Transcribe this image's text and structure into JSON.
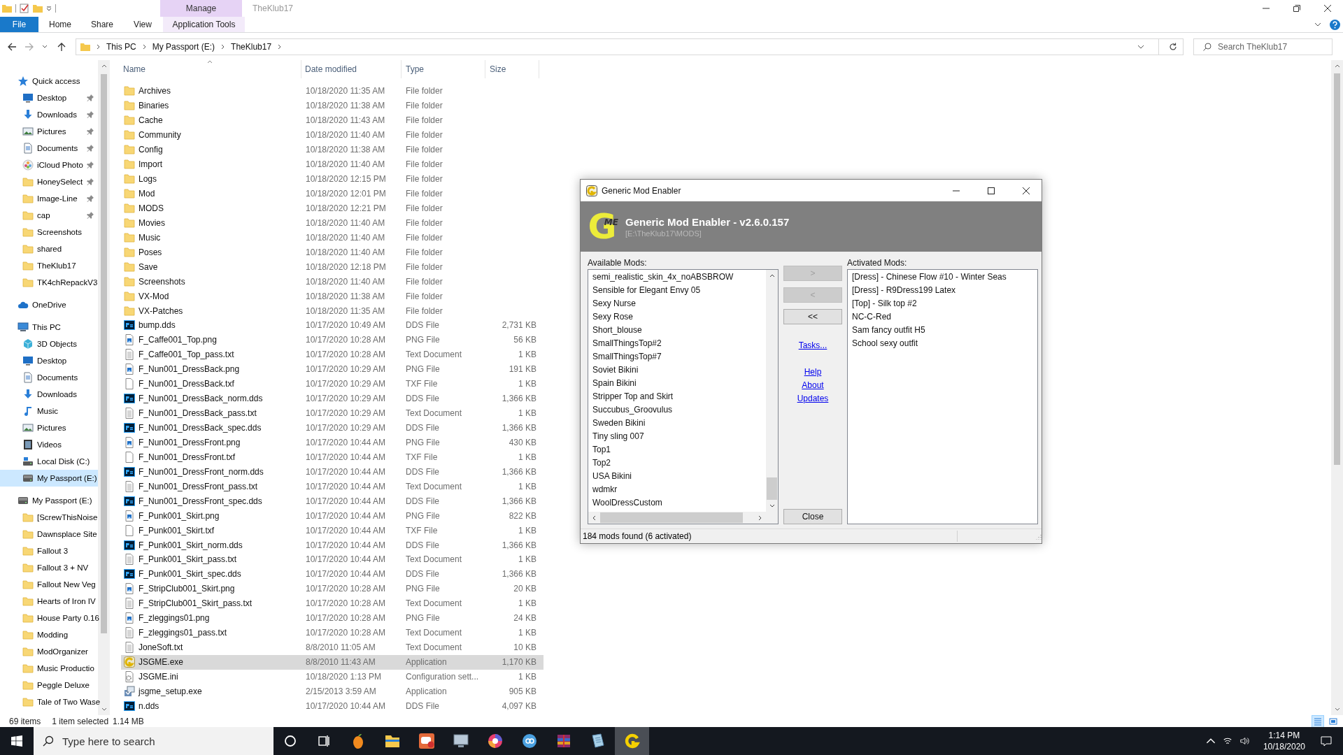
{
  "window": {
    "title": "TheKlub17",
    "context_tab": "Manage"
  },
  "ribbon": {
    "tabs": [
      {
        "label": "File",
        "kind": "file"
      },
      {
        "label": "Home",
        "kind": "tab"
      },
      {
        "label": "Share",
        "kind": "tab"
      },
      {
        "label": "View",
        "kind": "tab"
      },
      {
        "label": "Application Tools",
        "kind": "context"
      }
    ]
  },
  "address": {
    "crumbs": [
      "This PC",
      "My Passport (E:)",
      "TheKlub17"
    ]
  },
  "search": {
    "placeholder": "Search TheKlub17"
  },
  "sidebar": {
    "groups": [
      {
        "label": "Quick access",
        "kind": "star",
        "selected": false,
        "children": [
          {
            "label": "Desktop",
            "kind": "desktop",
            "pinned": true,
            "selected": false
          },
          {
            "label": "Downloads",
            "kind": "download",
            "pinned": true,
            "selected": false
          },
          {
            "label": "Pictures",
            "kind": "pictures",
            "pinned": true,
            "selected": false
          },
          {
            "label": "Documents",
            "kind": "documents",
            "pinned": true,
            "selected": false
          },
          {
            "label": "iCloud Photo",
            "kind": "photos",
            "pinned": true,
            "selected": false
          },
          {
            "label": "HoneySelect",
            "kind": "folder",
            "pinned": true,
            "selected": false
          },
          {
            "label": "Image-Line",
            "kind": "folder",
            "pinned": true,
            "selected": false
          },
          {
            "label": "cap",
            "kind": "folder",
            "pinned": true,
            "selected": false
          },
          {
            "label": "Screenshots",
            "kind": "folder",
            "pinned": false,
            "selected": false
          },
          {
            "label": "shared",
            "kind": "folder",
            "pinned": false,
            "selected": false
          },
          {
            "label": "TheKlub17",
            "kind": "folder",
            "pinned": false,
            "selected": false
          },
          {
            "label": "TK4chRepackV3",
            "kind": "folder",
            "pinned": false,
            "selected": false
          }
        ]
      },
      {
        "label": "OneDrive",
        "kind": "cloud",
        "selected": false
      },
      {
        "label": "This PC",
        "kind": "pc",
        "selected": false,
        "children": [
          {
            "label": "3D Objects",
            "kind": "cube",
            "selected": false
          },
          {
            "label": "Desktop",
            "kind": "desktop",
            "selected": false
          },
          {
            "label": "Documents",
            "kind": "documents",
            "selected": false
          },
          {
            "label": "Downloads",
            "kind": "download",
            "selected": false
          },
          {
            "label": "Music",
            "kind": "music",
            "selected": false
          },
          {
            "label": "Pictures",
            "kind": "pictures",
            "selected": false
          },
          {
            "label": "Videos",
            "kind": "video",
            "selected": false
          },
          {
            "label": "Local Disk (C:)",
            "kind": "disk",
            "selected": false
          },
          {
            "label": "My Passport (E:)",
            "kind": "drive",
            "selected": true
          }
        ]
      },
      {
        "label": "My Passport (E:)",
        "kind": "drive",
        "selected": false,
        "children": [
          {
            "label": "[ScrewThisNoise",
            "kind": "folder",
            "selected": false
          },
          {
            "label": "Dawnsplace Site",
            "kind": "folder",
            "selected": false
          },
          {
            "label": "Fallout 3",
            "kind": "folder",
            "selected": false
          },
          {
            "label": "Fallout 3 + NV",
            "kind": "folder",
            "selected": false
          },
          {
            "label": "Fallout New Veg",
            "kind": "folder",
            "selected": false
          },
          {
            "label": "Hearts of Iron IV",
            "kind": "folder",
            "selected": false
          },
          {
            "label": "House Party 0.16",
            "kind": "folder",
            "selected": false
          },
          {
            "label": "Modding",
            "kind": "folder",
            "selected": false
          },
          {
            "label": "ModOrganizer",
            "kind": "folder",
            "selected": false
          },
          {
            "label": "Music Productio",
            "kind": "folder",
            "selected": false
          },
          {
            "label": "Peggle Deluxe",
            "kind": "folder",
            "selected": false
          },
          {
            "label": "Tale of Two Wase",
            "kind": "folder",
            "selected": false
          }
        ]
      }
    ]
  },
  "columns": [
    "Name",
    "Date modified",
    "Type",
    "Size"
  ],
  "files": [
    {
      "name": "Archives",
      "date": "10/18/2020 11:35 AM",
      "type": "File folder",
      "kind": "folder",
      "selected": false
    },
    {
      "name": "Binaries",
      "date": "10/18/2020 11:38 AM",
      "type": "File folder",
      "kind": "folder",
      "selected": false
    },
    {
      "name": "Cache",
      "date": "10/18/2020 11:43 AM",
      "type": "File folder",
      "kind": "folder",
      "selected": false
    },
    {
      "name": "Community",
      "date": "10/18/2020 11:40 AM",
      "type": "File folder",
      "kind": "folder",
      "selected": false
    },
    {
      "name": "Config",
      "date": "10/18/2020 11:38 AM",
      "type": "File folder",
      "kind": "folder",
      "selected": false
    },
    {
      "name": "Import",
      "date": "10/18/2020 11:40 AM",
      "type": "File folder",
      "kind": "folder",
      "selected": false
    },
    {
      "name": "Logs",
      "date": "10/18/2020 12:15 PM",
      "type": "File folder",
      "kind": "folder",
      "selected": false
    },
    {
      "name": "Mod",
      "date": "10/18/2020 12:01 PM",
      "type": "File folder",
      "kind": "folder",
      "selected": false
    },
    {
      "name": "MODS",
      "date": "10/18/2020 12:21 PM",
      "type": "File folder",
      "kind": "folder",
      "selected": false
    },
    {
      "name": "Movies",
      "date": "10/18/2020 11:40 AM",
      "type": "File folder",
      "kind": "folder",
      "selected": false
    },
    {
      "name": "Music",
      "date": "10/18/2020 11:40 AM",
      "type": "File folder",
      "kind": "folder",
      "selected": false
    },
    {
      "name": "Poses",
      "date": "10/18/2020 11:40 AM",
      "type": "File folder",
      "kind": "folder",
      "selected": false
    },
    {
      "name": "Save",
      "date": "10/18/2020 12:18 PM",
      "type": "File folder",
      "kind": "folder",
      "selected": false
    },
    {
      "name": "Screenshots",
      "date": "10/18/2020 11:40 AM",
      "type": "File folder",
      "kind": "folder",
      "selected": false
    },
    {
      "name": "VX-Mod",
      "date": "10/18/2020 11:38 AM",
      "type": "File folder",
      "kind": "folder",
      "selected": false
    },
    {
      "name": "VX-Patches",
      "date": "10/18/2020 11:35 AM",
      "type": "File folder",
      "kind": "folder",
      "selected": false
    },
    {
      "name": "bump.dds",
      "date": "10/17/2020 10:49 AM",
      "type": "DDS File",
      "size": "2,731 KB",
      "kind": "dds",
      "selected": false
    },
    {
      "name": "F_Caffe001_Top.png",
      "date": "10/17/2020 10:28 AM",
      "type": "PNG File",
      "size": "56 KB",
      "kind": "image",
      "selected": false
    },
    {
      "name": "F_Caffe001_Top_pass.txt",
      "date": "10/17/2020 10:28 AM",
      "type": "Text Document",
      "size": "1 KB",
      "kind": "text",
      "selected": false
    },
    {
      "name": "F_Nun001_DressBack.png",
      "date": "10/17/2020 10:29 AM",
      "type": "PNG File",
      "size": "191 KB",
      "kind": "image",
      "selected": false
    },
    {
      "name": "F_Nun001_DressBack.txf",
      "date": "10/17/2020 10:29 AM",
      "type": "TXF File",
      "size": "1 KB",
      "kind": "blank",
      "selected": false
    },
    {
      "name": "F_Nun001_DressBack_norm.dds",
      "date": "10/17/2020 10:29 AM",
      "type": "DDS File",
      "size": "1,366 KB",
      "kind": "dds",
      "selected": false
    },
    {
      "name": "F_Nun001_DressBack_pass.txt",
      "date": "10/17/2020 10:29 AM",
      "type": "Text Document",
      "size": "1 KB",
      "kind": "text",
      "selected": false
    },
    {
      "name": "F_Nun001_DressBack_spec.dds",
      "date": "10/17/2020 10:29 AM",
      "type": "DDS File",
      "size": "1,366 KB",
      "kind": "dds",
      "selected": false
    },
    {
      "name": "F_Nun001_DressFront.png",
      "date": "10/17/2020 10:44 AM",
      "type": "PNG File",
      "size": "430 KB",
      "kind": "image",
      "selected": false
    },
    {
      "name": "F_Nun001_DressFront.txf",
      "date": "10/17/2020 10:44 AM",
      "type": "TXF File",
      "size": "1 KB",
      "kind": "blank",
      "selected": false
    },
    {
      "name": "F_Nun001_DressFront_norm.dds",
      "date": "10/17/2020 10:44 AM",
      "type": "DDS File",
      "size": "1,366 KB",
      "kind": "dds",
      "selected": false
    },
    {
      "name": "F_Nun001_DressFront_pass.txt",
      "date": "10/17/2020 10:44 AM",
      "type": "Text Document",
      "size": "1 KB",
      "kind": "text",
      "selected": false
    },
    {
      "name": "F_Nun001_DressFront_spec.dds",
      "date": "10/17/2020 10:44 AM",
      "type": "DDS File",
      "size": "1,366 KB",
      "kind": "dds",
      "selected": false
    },
    {
      "name": "F_Punk001_Skirt.png",
      "date": "10/17/2020 10:44 AM",
      "type": "PNG File",
      "size": "822 KB",
      "kind": "image",
      "selected": false
    },
    {
      "name": "F_Punk001_Skirt.txf",
      "date": "10/17/2020 10:44 AM",
      "type": "TXF File",
      "size": "1 KB",
      "kind": "blank",
      "selected": false
    },
    {
      "name": "F_Punk001_Skirt_norm.dds",
      "date": "10/17/2020 10:44 AM",
      "type": "DDS File",
      "size": "1,366 KB",
      "kind": "dds",
      "selected": false
    },
    {
      "name": "F_Punk001_Skirt_pass.txt",
      "date": "10/17/2020 10:44 AM",
      "type": "Text Document",
      "size": "1 KB",
      "kind": "text",
      "selected": false
    },
    {
      "name": "F_Punk001_Skirt_spec.dds",
      "date": "10/17/2020 10:44 AM",
      "type": "DDS File",
      "size": "1,366 KB",
      "kind": "dds",
      "selected": false
    },
    {
      "name": "F_StripClub001_Skirt.png",
      "date": "10/17/2020 10:28 AM",
      "type": "PNG File",
      "size": "20 KB",
      "kind": "image",
      "selected": false
    },
    {
      "name": "F_StripClub001_Skirt_pass.txt",
      "date": "10/17/2020 10:28 AM",
      "type": "Text Document",
      "size": "1 KB",
      "kind": "text",
      "selected": false
    },
    {
      "name": "F_zleggings01.png",
      "date": "10/17/2020 10:28 AM",
      "type": "PNG File",
      "size": "24 KB",
      "kind": "image",
      "selected": false
    },
    {
      "name": "F_zleggings01_pass.txt",
      "date": "10/17/2020 10:28 AM",
      "type": "Text Document",
      "size": "1 KB",
      "kind": "text",
      "selected": false
    },
    {
      "name": "JoneSoft.txt",
      "date": "8/8/2010 11:05 AM",
      "type": "Text Document",
      "size": "10 KB",
      "kind": "text",
      "selected": false
    },
    {
      "name": "JSGME.exe",
      "date": "8/8/2010 11:43 AM",
      "type": "Application",
      "size": "1,170 KB",
      "kind": "gme",
      "selected": true
    },
    {
      "name": "JSGME.ini",
      "date": "10/18/2020 1:13 PM",
      "type": "Configuration sett...",
      "size": "1 KB",
      "kind": "config",
      "selected": false
    },
    {
      "name": "jsgme_setup.exe",
      "date": "2/15/2013 3:59 AM",
      "type": "Application",
      "size": "905 KB",
      "kind": "setup",
      "selected": false
    },
    {
      "name": "n.dds",
      "date": "10/17/2020 10:44 AM",
      "type": "DDS File",
      "size": "4,097 KB",
      "kind": "dds",
      "selected": false
    }
  ],
  "status_bar": {
    "count": "69 items",
    "selection": "1 item selected",
    "size": "1.14 MB"
  },
  "dialog": {
    "title": "Generic Mod Enabler",
    "logo": {
      "letter": "G",
      "mark": "ME"
    },
    "heading": "Generic Mod Enabler - v2.6.0.157",
    "path": "[E:\\TheKlub17\\MODS]",
    "available_label": "Available Mods:",
    "available": [
      "semi_realistic_skin_4x_noABSBROW",
      "Sensible for Elegant Envy 05",
      "Sexy Nurse",
      "Sexy Rose",
      "Short_blouse",
      "SmallThingsTop#2",
      "SmallThingsTop#7",
      "Soviet Bikini",
      "Spain Bikini",
      "Stripper Top and Skirt",
      "Succubus_Groovulus",
      "Sweden Bikini",
      "Tiny sling 007",
      "Top1",
      "Top2",
      "USA Bikini",
      "wdmkr",
      "WoolDressCustom"
    ],
    "buttons": [
      {
        "label": ">",
        "disabled": true
      },
      {
        "label": "<",
        "disabled": true
      },
      {
        "label": "<<",
        "disabled": false
      }
    ],
    "links": [
      {
        "label": "Tasks...",
        "kind": "tasks"
      },
      {
        "label": "Help",
        "kind": "group"
      },
      {
        "label": "About",
        "kind": "group"
      },
      {
        "label": "Updates",
        "kind": "group"
      }
    ],
    "close": "Close",
    "activated_label": "Activated Mods:",
    "activated": [
      "[Dress] - Chinese Flow #10 - Winter Seas",
      "[Dress] - R9Dress199 Latex",
      "[Top] - Silk top #2",
      "NC-C-Red",
      "Sam fancy outfit H5",
      "School sexy outfit"
    ],
    "status": "184 mods found (6 activated)"
  },
  "taskbar": {
    "search_placeholder": "Type here to search",
    "apps": [
      {
        "kind": "fruit",
        "active": false
      },
      {
        "kind": "explorer",
        "active": false
      },
      {
        "kind": "chat",
        "active": false
      },
      {
        "kind": "monitor",
        "active": false
      },
      {
        "kind": "browser",
        "active": false
      },
      {
        "kind": "torrent",
        "active": false
      },
      {
        "kind": "archive",
        "active": false
      },
      {
        "kind": "notepad",
        "active": false
      },
      {
        "kind": "gme",
        "active": true
      }
    ],
    "time": "1:14 PM",
    "date": "10/18/2020"
  }
}
